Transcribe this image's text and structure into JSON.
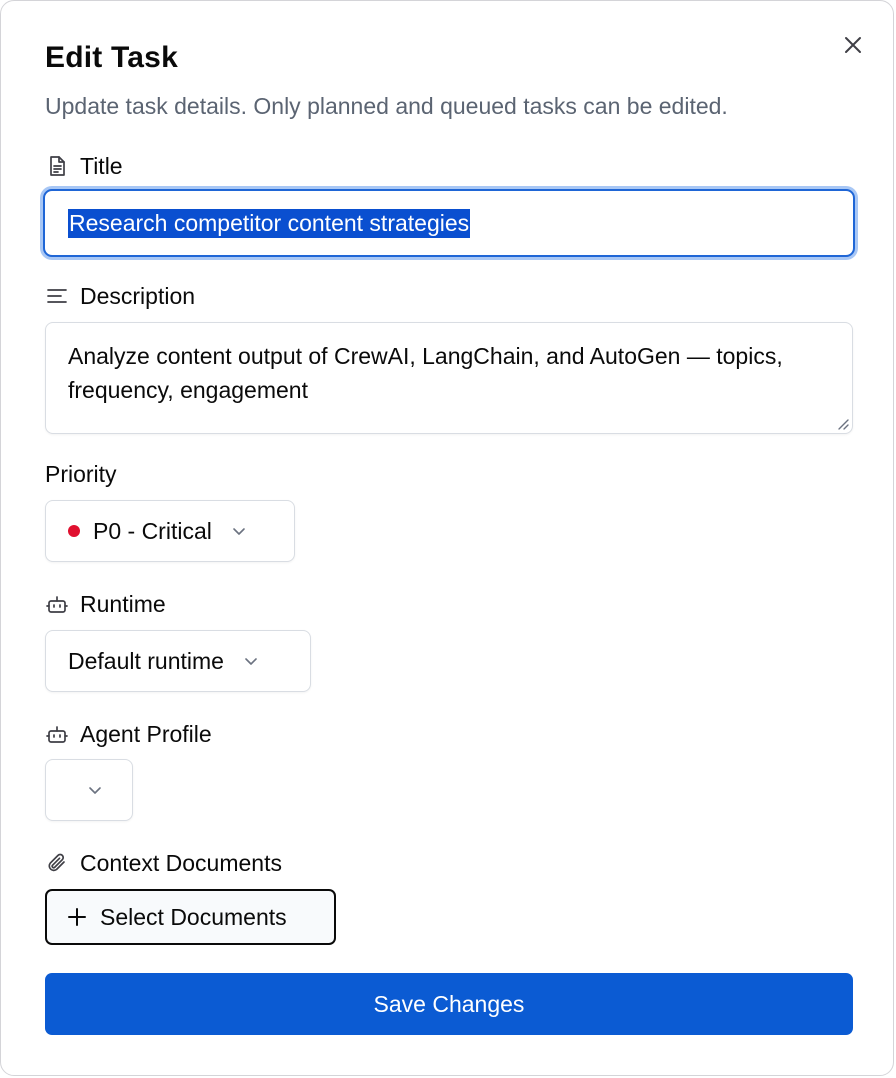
{
  "dialog": {
    "title": "Edit Task",
    "subtitle": "Update task details. Only planned and queued tasks can be edited."
  },
  "fields": {
    "title_label": "Title",
    "title_value": "Research competitor content strategies",
    "description_label": "Description",
    "description_value": "Analyze content output of CrewAI, LangChain, and AutoGen — topics, frequency, engagement",
    "priority_label": "Priority",
    "priority_value": "P0 - Critical",
    "priority_color": "#e0102f",
    "runtime_label": "Runtime",
    "runtime_value": "Default runtime",
    "agent_profile_label": "Agent Profile",
    "agent_profile_value": "",
    "context_documents_label": "Context Documents"
  },
  "actions": {
    "select_documents": "Select Documents",
    "save": "Save Changes"
  },
  "icons": {
    "close": "close-icon",
    "title": "file-text-icon",
    "description": "align-left-icon",
    "runtime": "bot-icon",
    "agent_profile": "bot-icon",
    "context_documents": "paperclip-icon",
    "select_documents": "plus-icon",
    "dropdown": "chevron-down-icon"
  },
  "colors": {
    "accent": "#0b5bd3",
    "focus_ring": "#a8c7f5",
    "selection": "#0a4fd0"
  }
}
